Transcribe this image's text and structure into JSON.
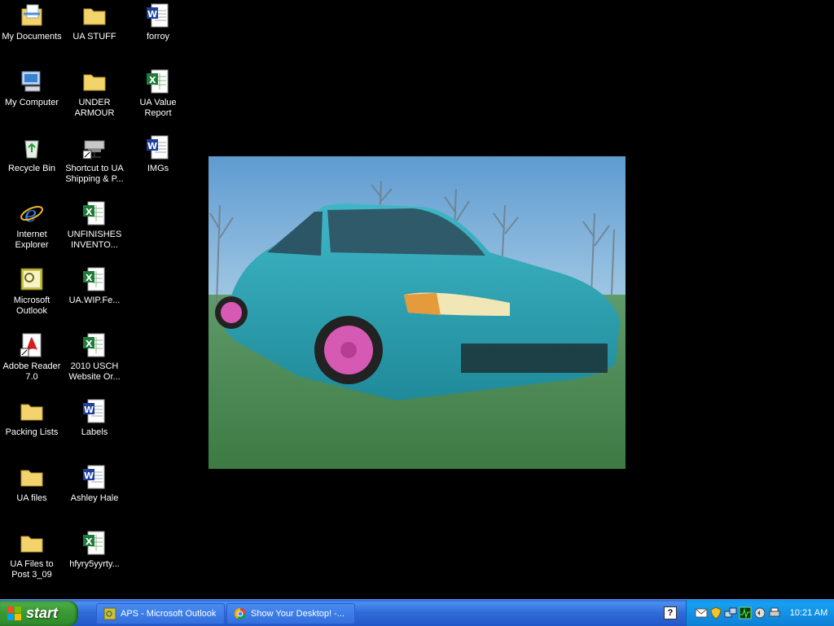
{
  "desktop": {
    "icons": [
      {
        "label": "My Documents",
        "icon": "my-documents-icon"
      },
      {
        "label": "My Computer",
        "icon": "my-computer-icon"
      },
      {
        "label": "Recycle Bin",
        "icon": "recycle-bin-icon"
      },
      {
        "label": "Internet Explorer",
        "icon": "internet-explorer-icon"
      },
      {
        "label": "Microsoft Outlook",
        "icon": "outlook-icon"
      },
      {
        "label": "Adobe Reader 7.0",
        "icon": "adobe-reader-icon"
      },
      {
        "label": "Packing Lists",
        "icon": "folder-icon"
      },
      {
        "label": "UA files",
        "icon": "folder-icon"
      },
      {
        "label": "UA Files to Post 3_09",
        "icon": "folder-icon"
      },
      {
        "label": "UA STUFF",
        "icon": "folder-icon"
      },
      {
        "label": "UNDER ARMOUR",
        "icon": "folder-icon"
      },
      {
        "label": "Shortcut to UA Shipping & P...",
        "icon": "network-drive-shortcut-icon"
      },
      {
        "label": "UNFINISHES INVENTO...",
        "icon": "excel-file-icon"
      },
      {
        "label": "UA.WIP.Fe...",
        "icon": "excel-file-icon"
      },
      {
        "label": "2010 USCH Website Or...",
        "icon": "excel-file-icon"
      },
      {
        "label": "Labels",
        "icon": "word-file-icon"
      },
      {
        "label": "Ashley Hale",
        "icon": "word-file-icon"
      },
      {
        "label": "hfyry5yyrty...",
        "icon": "excel-file-icon"
      },
      {
        "label": "forroy",
        "icon": "word-file-icon"
      },
      {
        "label": "UA Value Report",
        "icon": "excel-file-icon"
      },
      {
        "label": "IMGs",
        "icon": "word-file-icon"
      }
    ]
  },
  "wallpaper": {
    "subject": "teal-car-photo"
  },
  "taskbar": {
    "start_label": "start",
    "tasks": [
      {
        "label": "APS - Microsoft Outlook",
        "icon": "outlook-icon"
      },
      {
        "label": "Show Your Desktop! -...",
        "icon": "chrome-icon"
      }
    ],
    "help_glyph": "?",
    "clock": "10:21 AM"
  },
  "colors": {
    "taskbar_blue": "#2f6bd8",
    "start_green": "#3b9a35",
    "tray_blue": "#118ee2"
  }
}
